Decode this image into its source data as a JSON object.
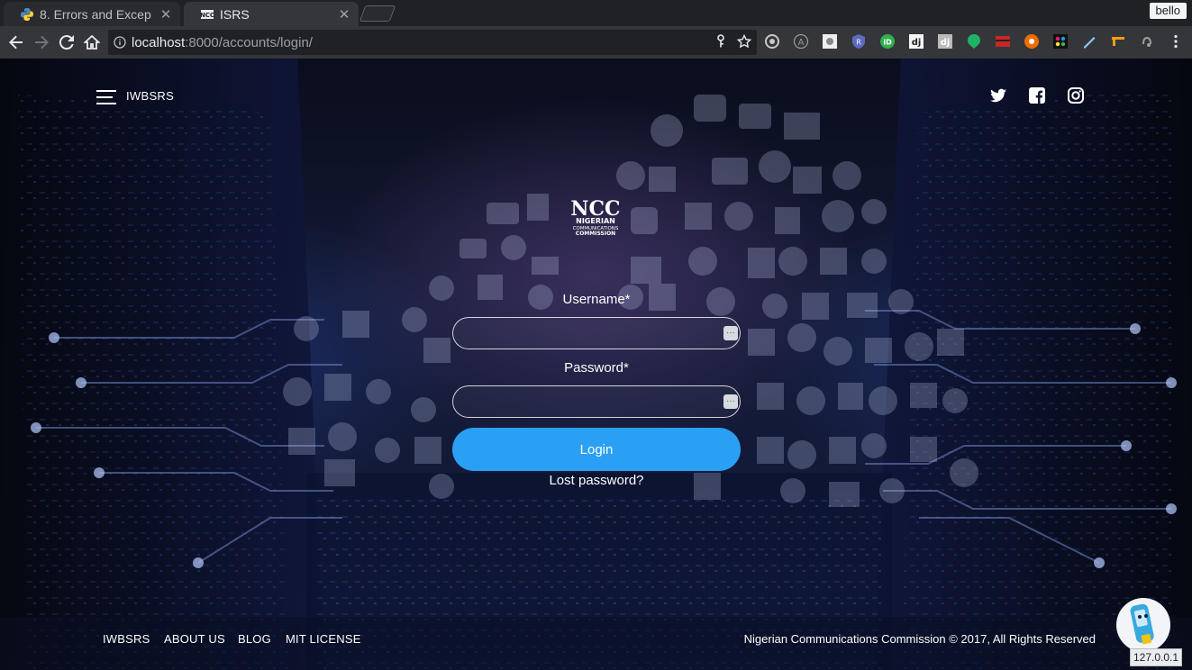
{
  "browser": {
    "tabs": [
      {
        "title": "8. Errors and Excep",
        "active": false
      },
      {
        "title": "ISRS",
        "active": true
      }
    ],
    "profile_name": "bello",
    "url": {
      "host": "localhost",
      "rest": ":8000/accounts/login/"
    },
    "extension_icons": [
      "target-icon",
      "a-circle-icon",
      "photo-icon",
      "r-shield-icon",
      "id-icon",
      "dj-icon",
      "dj-alt-icon",
      "leaf-icon",
      "red-box-icon",
      "orange-flower-icon",
      "color-picker-icon",
      "pen-icon",
      "key-icon",
      "bell-icon",
      "menu-dots-icon"
    ]
  },
  "header": {
    "brand": "IWBSRS",
    "social": [
      "twitter-icon",
      "facebook-icon",
      "instagram-icon"
    ]
  },
  "logo": {
    "mark": "NCC",
    "line1": "NIGERIAN",
    "line2": "COMMUNICATIONS",
    "line3": "COMMISSION"
  },
  "form": {
    "username_label": "Username*",
    "username_value": "",
    "password_label": "Password*",
    "password_value": "",
    "login_label": "Login",
    "lost_password": "Lost password?"
  },
  "footer": {
    "links": [
      "IWBSRS",
      "ABOUT US",
      "BLOG",
      "MIT LICENSE"
    ],
    "copyright": "Nigerian Communications Commission © 2017, All Rights Reserved"
  },
  "overlay": {
    "ip_badge": "127.0.0.1"
  },
  "colors": {
    "accent": "#2aa0f4",
    "chrome_dark": "#202124",
    "chrome_toolbar": "#35363a"
  }
}
